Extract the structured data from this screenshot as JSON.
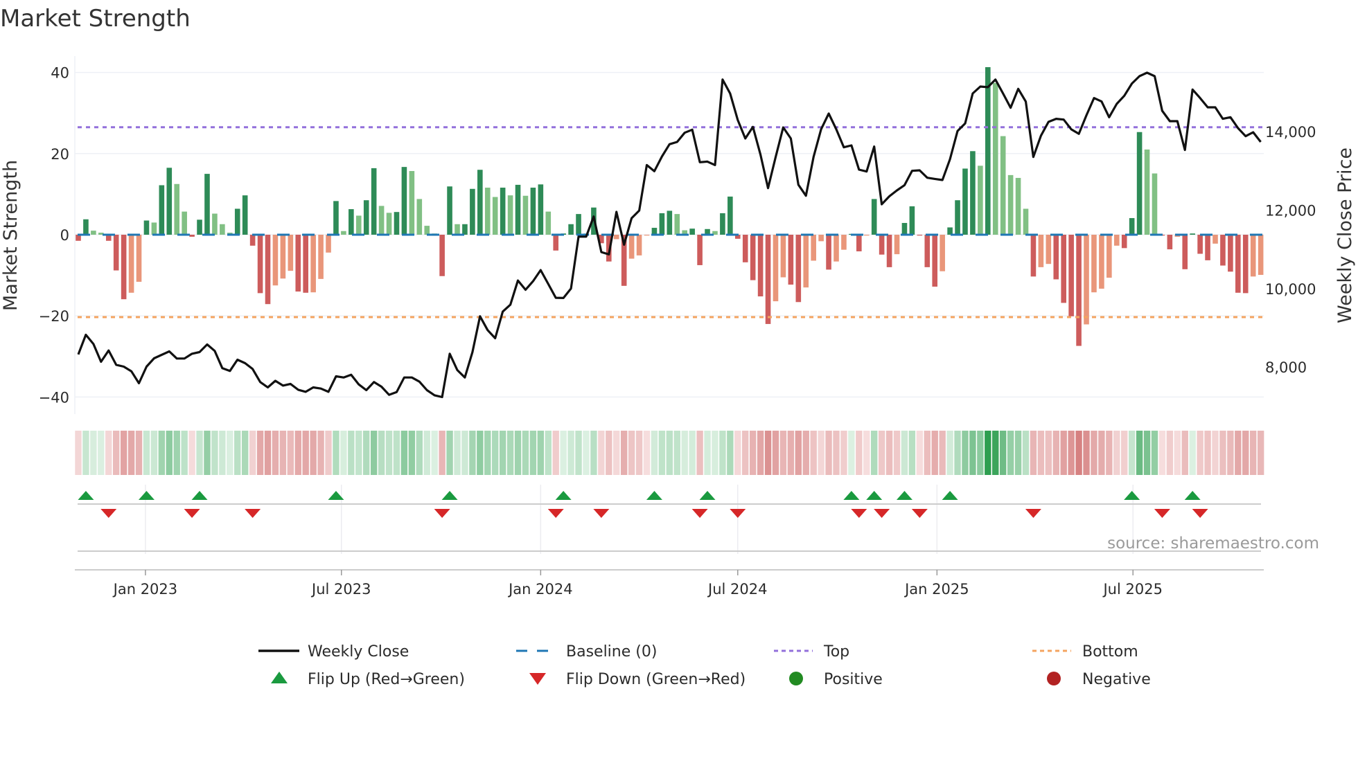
{
  "chart_data": {
    "type": "bar",
    "title": "Market Strength",
    "ylabel": "Market Strength",
    "y2label": "Weekly Close Price",
    "ylim": [
      -44,
      44
    ],
    "y2lim": [
      6800,
      15900
    ],
    "x_start": "2022-10-31",
    "x_step_days": 7,
    "left_ticks": [
      {
        "value": 40,
        "label": "40"
      },
      {
        "value": 20,
        "label": "20"
      },
      {
        "value": 0,
        "label": "0"
      },
      {
        "value": -20,
        "label": "−20"
      },
      {
        "value": -40,
        "label": "−40"
      }
    ],
    "right_ticks": [
      {
        "value": 14000,
        "label": "14,000"
      },
      {
        "value": 12000,
        "label": "12,000"
      },
      {
        "value": 10000,
        "label": "10,000"
      },
      {
        "value": 8000,
        "label": "8,000"
      }
    ],
    "x_ticks": [
      {
        "date": "2023-01-01",
        "label": "Jan 2023"
      },
      {
        "date": "2023-07-01",
        "label": "Jul 2023"
      },
      {
        "date": "2024-01-01",
        "label": "Jan 2024"
      },
      {
        "date": "2024-07-01",
        "label": "Jul 2024"
      },
      {
        "date": "2025-01-01",
        "label": "Jan 2025"
      },
      {
        "date": "2025-07-01",
        "label": "Jul 2025"
      }
    ],
    "top_level": 26.5,
    "bottom_level": -20.3,
    "baseline": 0,
    "strength": [
      -1.5,
      3.8,
      1.0,
      0.5,
      -1.5,
      -8.8,
      -15.9,
      -14.3,
      -11.6,
      3.5,
      3.0,
      12.2,
      16.5,
      12.5,
      5.7,
      -0.5,
      3.7,
      15.0,
      5.2,
      2.6,
      0.5,
      6.4,
      9.7,
      -2.7,
      -14.4,
      -17.1,
      -12.5,
      -10.8,
      -8.9,
      -14.0,
      -14.3,
      -14.2,
      -10.9,
      -4.4,
      8.3,
      0.9,
      6.3,
      4.7,
      8.5,
      16.4,
      7.1,
      5.4,
      5.6,
      16.7,
      15.7,
      8.8,
      2.2,
      0.3,
      -10.2,
      11.9,
      2.6,
      2.6,
      11.3,
      16.0,
      11.6,
      9.3,
      11.6,
      9.7,
      12.3,
      9.6,
      11.6,
      12.4,
      5.7,
      -3.9,
      0.3,
      2.6,
      5.1,
      0.3,
      6.7,
      -2.1,
      -6.6,
      -1.1,
      -12.6,
      -5.9,
      -5.1,
      -0.2,
      1.7,
      5.3,
      5.9,
      5.1,
      1.1,
      1.5,
      -7.5,
      1.4,
      0.9,
      5.3,
      9.4,
      -1.0,
      -6.8,
      -11.2,
      -15.2,
      -22.0,
      -16.4,
      -10.5,
      -12.3,
      -16.6,
      -13.0,
      -6.4,
      -1.6,
      -8.6,
      -6.6,
      -3.7,
      0.2,
      -4.1,
      -0.2,
      8.8,
      -4.9,
      -8.0,
      -4.8,
      2.9,
      7.0,
      -0.2,
      -8.0,
      -12.8,
      -9.0,
      1.8,
      8.5,
      16.3,
      20.6,
      17.0,
      41.3,
      37.4,
      24.3,
      14.7,
      14.0,
      6.4,
      -10.3,
      -8.0,
      -7.2,
      -11.0,
      -16.8,
      -20.1,
      -27.4,
      -22.1,
      -14.2,
      -13.3,
      -10.6,
      -2.7,
      -3.3,
      4.1,
      25.3,
      21.0,
      15.1,
      -0.2,
      -3.6,
      -0.5,
      -8.5,
      0.3,
      -4.7,
      -6.3,
      -2.2,
      -7.6,
      -9.1,
      -14.3,
      -14.4,
      -10.3,
      -9.9
    ],
    "weekly_close": [
      8322,
      8823,
      8587,
      8135,
      8423,
      8057,
      8011,
      7893,
      7588,
      8011,
      8223,
      8311,
      8400,
      8217,
      8217,
      8340,
      8382,
      8576,
      8411,
      7970,
      7900,
      8188,
      8100,
      7952,
      7617,
      7482,
      7650,
      7528,
      7570,
      7422,
      7369,
      7482,
      7452,
      7369,
      7764,
      7734,
      7805,
      7558,
      7411,
      7617,
      7499,
      7293,
      7364,
      7734,
      7734,
      7628,
      7411,
      7281,
      7235,
      8340,
      7923,
      7734,
      8382,
      9293,
      8940,
      8735,
      9411,
      9588,
      10205,
      9970,
      10188,
      10470,
      10117,
      9764,
      9760,
      10000,
      11323,
      11323,
      11835,
      10929,
      10870,
      11953,
      11117,
      11794,
      11988,
      13147,
      12989,
      13365,
      13677,
      13735,
      13970,
      14047,
      13218,
      13235,
      13147,
      15324,
      14971,
      14294,
      13824,
      14118,
      13412,
      12558,
      13353,
      14106,
      13824,
      12646,
      12364,
      13353,
      14059,
      14459,
      14059,
      13600,
      13647,
      13029,
      12982,
      13618,
      12147,
      12350,
      12500,
      12635,
      12999,
      13012,
      12823,
      12794,
      12765,
      13294,
      14012,
      14206,
      14971,
      15147,
      15130,
      15324,
      14971,
      14606,
      15088,
      14764,
      13353,
      13894,
      14247,
      14324,
      14306,
      14059,
      13941,
      14412,
      14853,
      14765,
      14365,
      14706,
      14912,
      15224,
      15412,
      15500,
      15412,
      14530,
      14265,
      14265,
      13530,
      15071,
      14853,
      14618,
      14618,
      14324,
      14365,
      14088,
      13882,
      13982,
      13735
    ],
    "flip_up_weeks": [
      2,
      10,
      17,
      35,
      50,
      65,
      77,
      84,
      103,
      106,
      110,
      116,
      140,
      148
    ],
    "flip_down_weeks": [
      5,
      16,
      24,
      49,
      64,
      70,
      83,
      88,
      104,
      107,
      112,
      127,
      144,
      149
    ],
    "legend": [
      {
        "key": "weekly_close",
        "label": "Weekly Close"
      },
      {
        "key": "baseline",
        "label": "Baseline (0)"
      },
      {
        "key": "top",
        "label": "Top"
      },
      {
        "key": "bottom",
        "label": "Bottom"
      },
      {
        "key": "flip_up",
        "label": "Flip Up (Red→Green)"
      },
      {
        "key": "flip_down",
        "label": "Flip Down (Green→Red)"
      },
      {
        "key": "positive",
        "label": "Positive"
      },
      {
        "key": "negative",
        "label": "Negative"
      }
    ],
    "legend_placement": "bottom",
    "annotation": "source: sharemaestro.com"
  },
  "colors": {
    "rising_positive": "#2e8b57",
    "falling_positive": "#81c084",
    "falling_negative": "#cd5c5c",
    "recovering_negative": "#e9967a",
    "price_line": "#111111",
    "baseline": "#1f77b4",
    "top": "#9370db",
    "bottom": "#f4a460",
    "flip_up": "#1a9a3f",
    "flip_down": "#d62728",
    "positive": "#228b22",
    "negative": "#b22222",
    "grid": "#eef0f6",
    "axis": "#cccccc"
  }
}
